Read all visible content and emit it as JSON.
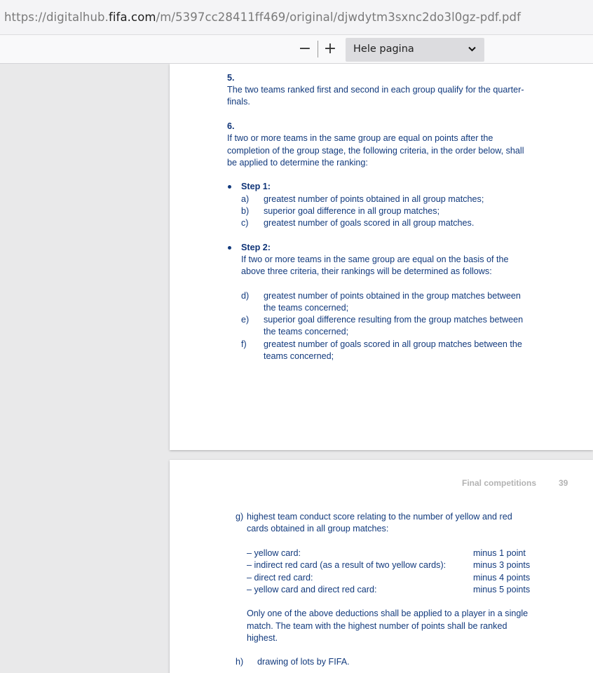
{
  "browser": {
    "url_prefix": "https://digitalhub.",
    "url_host": "fifa.com",
    "url_path": "/m/5397cc28411ff469/original/djwdytm3sxnc2do3l0gz-pdf.pdf"
  },
  "toolbar": {
    "zoom_out_label": "−",
    "zoom_in_label": "+",
    "zoom_value": "Hele pagina"
  },
  "page1": {
    "n5": "5.",
    "p5_l1": "The two teams ranked first and second in each group qualify for the quarter-",
    "p5_l2": "finals.",
    "n6": "6.",
    "p6_l1": "If two or more teams in the same group are equal on points after the",
    "p6_l2": "completion of the group stage, the following criteria, in the order below, shall",
    "p6_l3": "be applied to determine the ranking:",
    "step1": "Step 1:",
    "a_m": "a)",
    "a_t": "greatest number of points obtained in all group matches;",
    "b_m": "b)",
    "b_t": "superior goal difference in all group matches;",
    "c_m": "c)",
    "c_t": "greatest number of goals scored in all group matches.",
    "step2": "Step 2:",
    "s2_l1": "If two or more teams in the same group are equal on the basis of the",
    "s2_l2": "above three criteria, their rankings will be determined as follows:",
    "d_m": "d)",
    "d_t1": "greatest number of points obtained in the group matches between",
    "d_t2": "the teams concerned;",
    "e_m": "e)",
    "e_t1": "superior goal difference resulting from the group matches between",
    "e_t2": "the teams concerned;",
    "f_m": "f)",
    "f_t1": "greatest number of goals scored in all group matches between the",
    "f_t2": "teams concerned;"
  },
  "page2": {
    "header_title": "Final competitions",
    "page_number": "39",
    "g_m": "g)",
    "g_l1": "highest team conduct score relating to the number of yellow and red",
    "g_l2": "cards obtained in all group matches:",
    "deductions": [
      {
        "label": "– yellow card:",
        "value": "minus 1 point"
      },
      {
        "label": "– indirect red card (as a result of two yellow cards):",
        "value": "minus 3 points"
      },
      {
        "label": "– direct red card:",
        "value": "minus 4 points"
      },
      {
        "label": "– yellow card and direct red card:",
        "value": "minus 5 points"
      }
    ],
    "note_l1": "Only one of the above deductions shall be applied to a player in a single",
    "note_l2": "match. The team with the highest number of points shall be ranked",
    "note_l3": "highest.",
    "h_m": "h)",
    "h_t": "drawing of lots by FIFA."
  }
}
